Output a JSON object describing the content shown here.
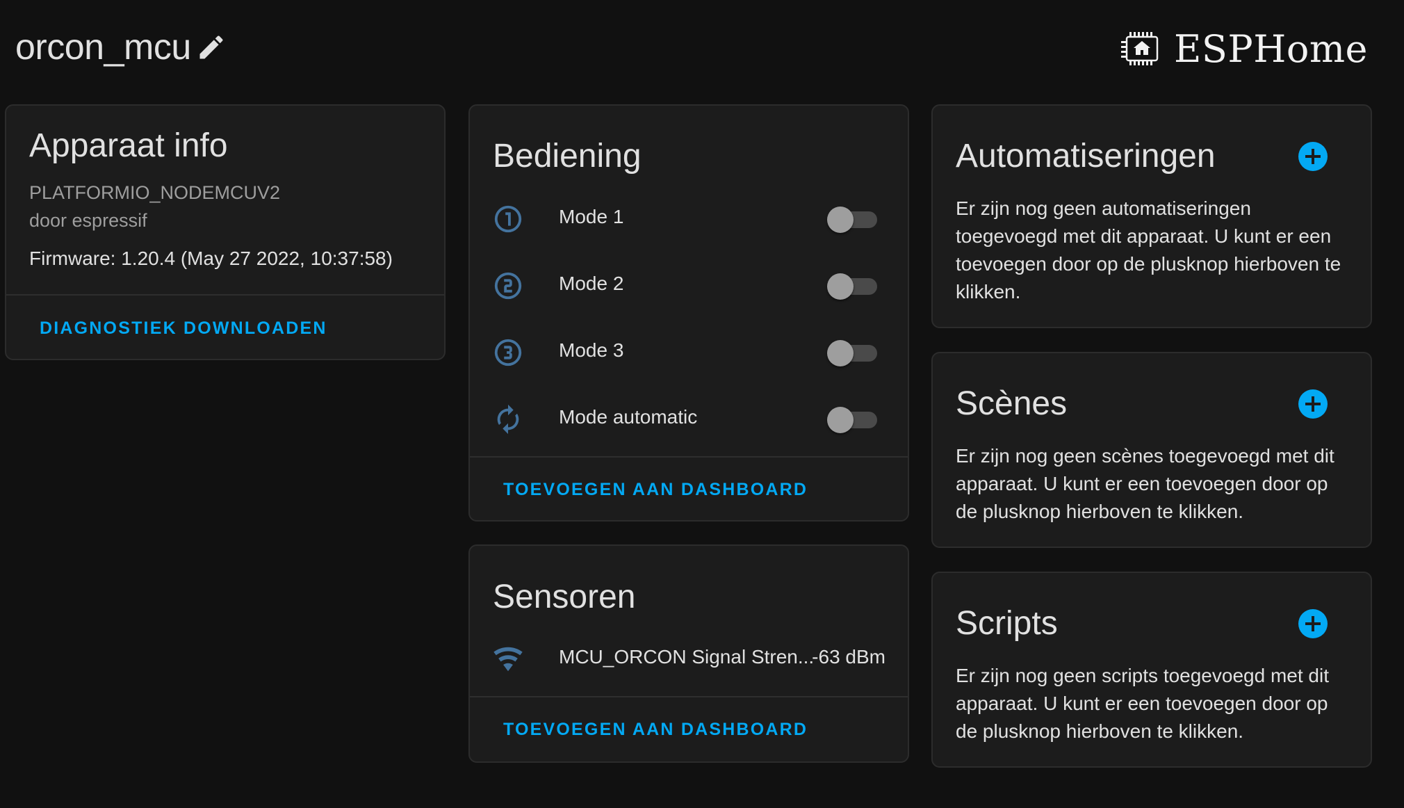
{
  "header": {
    "device_name": "orcon_mcu",
    "brand": "ESPHome"
  },
  "device_info": {
    "title": "Apparaat info",
    "model": "PLATFORMIO_NODEMCUV2",
    "manufacturer": "door espressif",
    "firmware": "Firmware: 1.20.4 (May 27 2022, 10:37:58)",
    "action": "DIAGNOSTIEK DOWNLOADEN"
  },
  "controls": {
    "title": "Bediening",
    "items": [
      {
        "label": "Mode 1",
        "icon": "numeric-1-circle-icon",
        "state": "off"
      },
      {
        "label": "Mode 2",
        "icon": "numeric-2-circle-icon",
        "state": "off"
      },
      {
        "label": "Mode 3",
        "icon": "numeric-3-circle-icon",
        "state": "off"
      },
      {
        "label": "Mode automatic",
        "icon": "autorenew-icon",
        "state": "off"
      }
    ],
    "action": "TOEVOEGEN AAN DASHBOARD"
  },
  "sensors": {
    "title": "Sensoren",
    "items": [
      {
        "label": "MCU_ORCON Signal Stren...",
        "value": "-63 dBm",
        "icon": "wifi-icon"
      }
    ],
    "action": "TOEVOEGEN AAN DASHBOARD"
  },
  "automations": {
    "title": "Automatiseringen",
    "empty_text": "Er zijn nog geen automatiseringen toegevoegd met dit apparaat. U kunt er een toevoegen door op de plusknop hierboven te klikken."
  },
  "scenes": {
    "title": "Scènes",
    "empty_text": "Er zijn nog geen scènes toegevoegd met dit apparaat. U kunt er een toevoegen door op de plusknop hierboven te klikken."
  },
  "scripts": {
    "title": "Scripts",
    "empty_text": "Er zijn nog geen scripts toegevoegd met dit apparaat. U kunt er een toevoegen door op de plusknop hierboven te klikken."
  },
  "colors": {
    "accent": "#03a9f4",
    "icon": "#44739e",
    "background": "#111111",
    "card": "#1c1c1c"
  }
}
